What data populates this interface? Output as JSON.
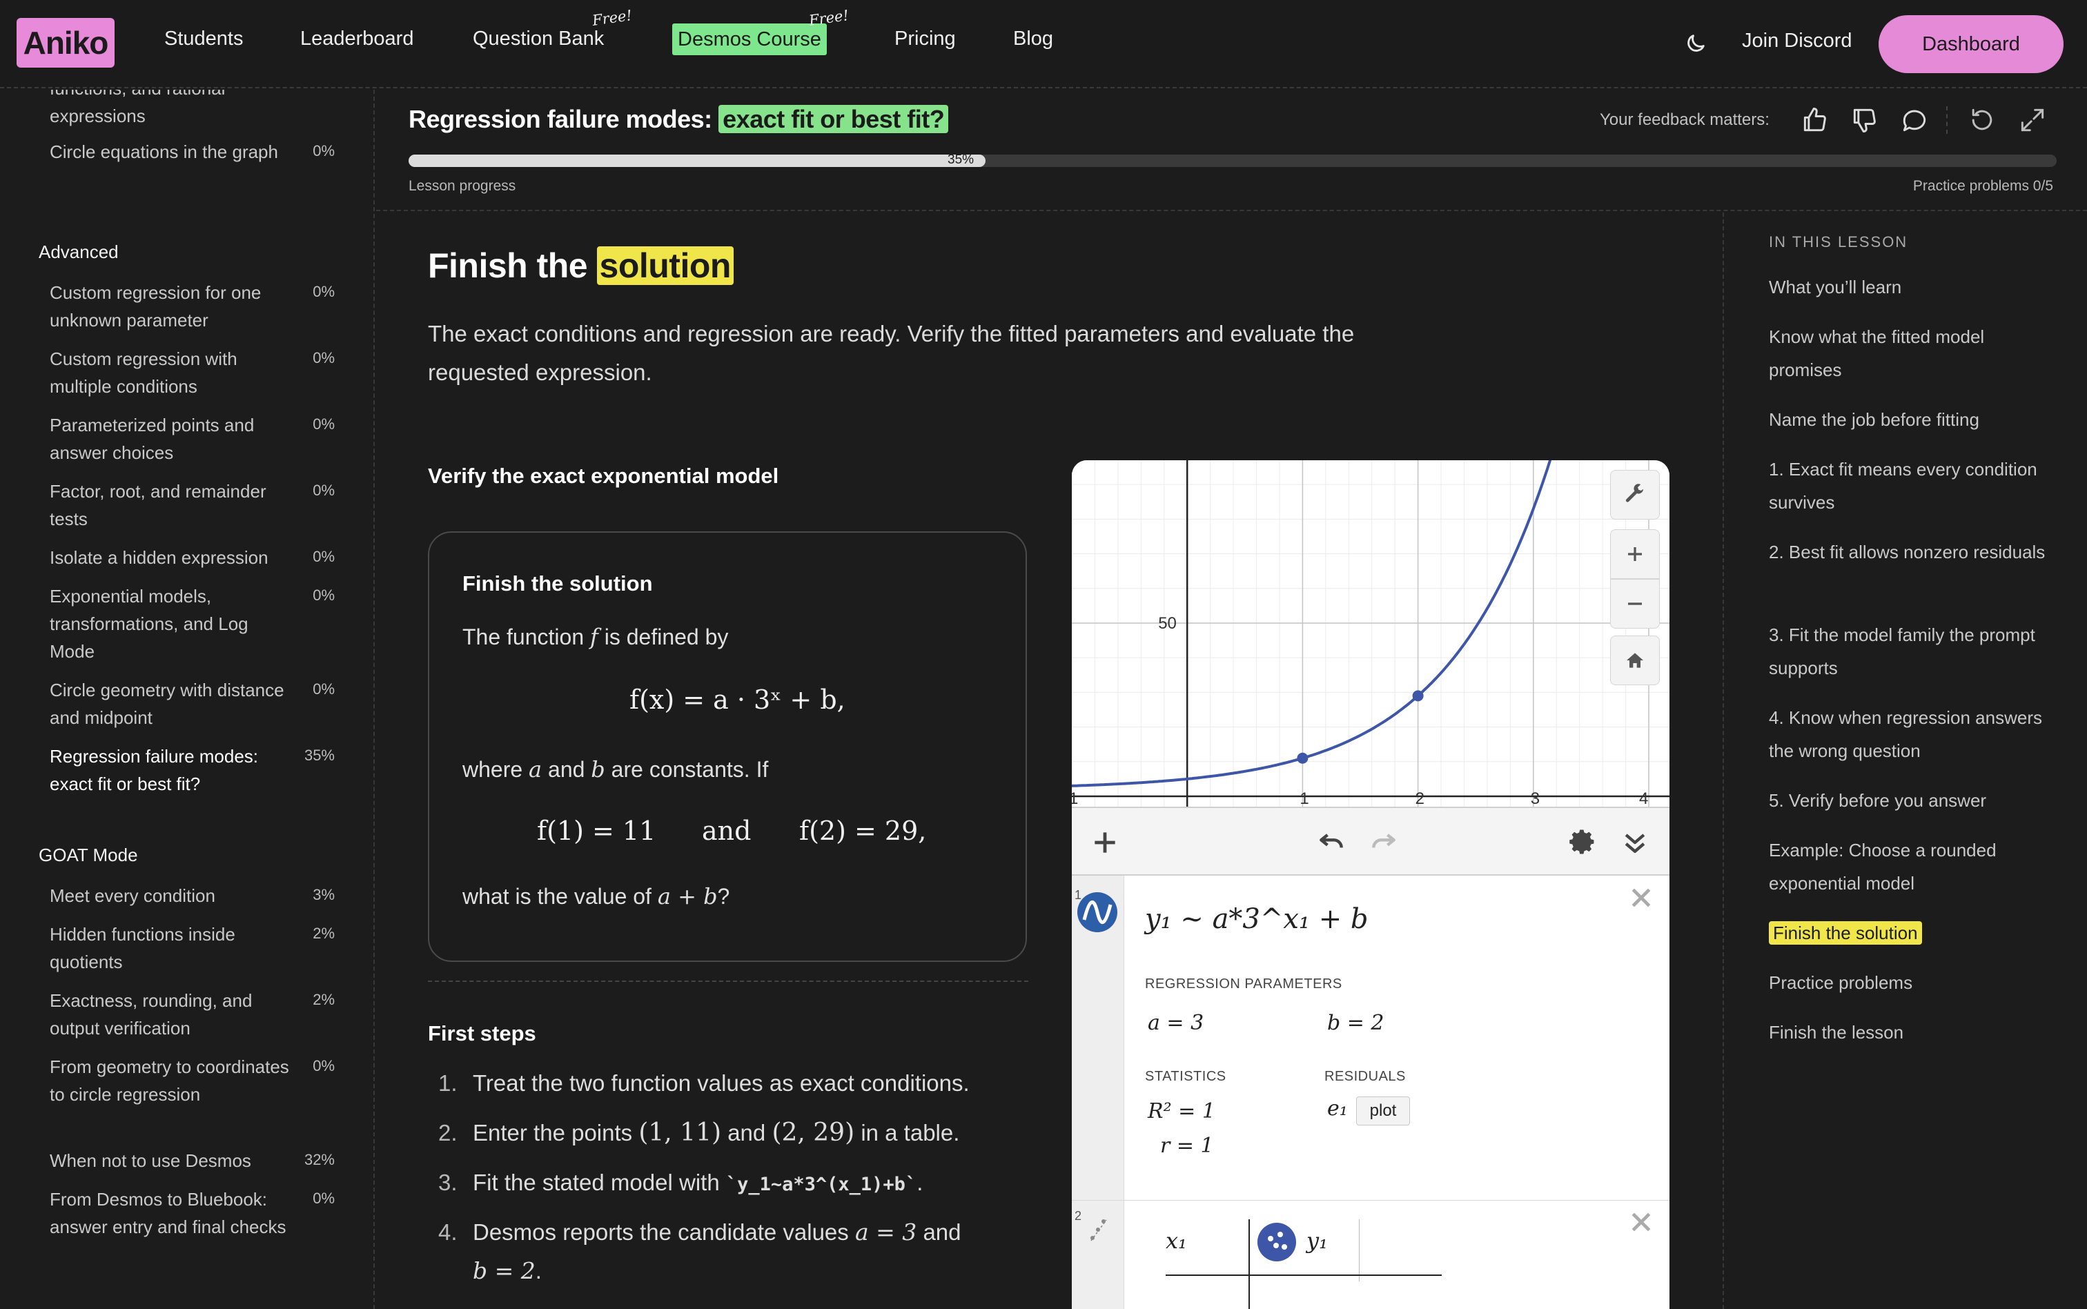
{
  "nav": {
    "logo": "Aniko",
    "students": "Students",
    "leaderboard": "Leaderboard",
    "question_bank": "Question Bank",
    "question_bank_badge": "Free!",
    "desmos_course": "Desmos Course",
    "desmos_course_badge": "Free!",
    "pricing": "Pricing",
    "blog": "Blog",
    "join_discord": "Join Discord",
    "dashboard": "Dashboard"
  },
  "sidebar": {
    "partial_item": "functions, and rational expressions",
    "items_top": [
      {
        "label": "Circle equations in the graph",
        "pct": "0%"
      }
    ],
    "advanced_heading": "Advanced",
    "advanced": [
      {
        "label": "Custom regression for one unknown parameter",
        "pct": "0%"
      },
      {
        "label": "Custom regression with multiple conditions",
        "pct": "0%"
      },
      {
        "label": "Parameterized points and answer choices",
        "pct": "0%"
      },
      {
        "label": "Factor, root, and remainder tests",
        "pct": "0%"
      },
      {
        "label": "Isolate a hidden expression",
        "pct": "0%"
      },
      {
        "label": "Exponential models, transformations, and Log Mode",
        "pct": "0%"
      },
      {
        "label": "Circle geometry with distance and midpoint",
        "pct": "0%"
      },
      {
        "label": "Regression failure modes: exact fit or best fit?",
        "pct": "35%"
      }
    ],
    "goat_heading": "GOAT Mode",
    "goat": [
      {
        "label": "Meet every condition",
        "pct": "3%"
      },
      {
        "label": "Hidden functions inside quotients",
        "pct": "2%"
      },
      {
        "label": "Exactness, rounding, and output verification",
        "pct": "2%"
      },
      {
        "label": "From geometry to coordinates to circle regression",
        "pct": "0%"
      },
      {
        "label": "When not to use Desmos",
        "pct": "32%"
      },
      {
        "label": "From Desmos to Bluebook: answer entry and final checks",
        "pct": "0%"
      }
    ]
  },
  "lesson": {
    "title_prefix": "Regression failure modes:",
    "title_highlight": "exact fit or best fit?",
    "feedback_label": "Your feedback matters:",
    "progress": 0.35,
    "progress_text": "35%",
    "progress_label": "Lesson progress",
    "practice_label": "Practice problems 0/5"
  },
  "main": {
    "heading_prefix": "Finish the",
    "heading_highlight": "solution",
    "intro": "The exact conditions and regression are ready. Verify the fitted parameters and evaluate the requested expression.",
    "section_title": "Verify the exact exponential model",
    "problem": {
      "title": "Finish the solution",
      "line1_a": "The function",
      "line1_var": "f",
      "line1_b": "is defined by",
      "equation": "f(x) = a · 3ˣ + b,",
      "line2_a": "where",
      "line2_v1": "a",
      "line2_and": "and",
      "line2_v2": "b",
      "line2_b": "are constants. If",
      "cond1": "f(1) = 11",
      "cond_and": "and",
      "cond2": "f(2) = 29,",
      "line3_a": "what is the value of",
      "line3_expr": "a + b",
      "line3_q": "?"
    },
    "steps_title": "First steps",
    "steps": [
      {
        "num": "1.",
        "text": "Treat the two function values as exact conditions."
      },
      {
        "num": "2.",
        "text_a": "Enter the points",
        "p1": "(1, 11)",
        "and": "and",
        "p2": "(2, 29)",
        "text_b": "in a table."
      },
      {
        "num": "3.",
        "text_a": "Fit the stated model with",
        "code": "`y_1~a*3^(x_1)+b`",
        "text_b": "."
      },
      {
        "num": "4.",
        "text_a": "Desmos reports the candidate values",
        "v1": "a = 3",
        "and": "and",
        "v2": "b = 2",
        "text_b": "."
      }
    ]
  },
  "desmos": {
    "axis": {
      "x_ticks": [
        "1",
        "1",
        "2",
        "3",
        "4"
      ],
      "y_tick": "50"
    },
    "expr1_num": "1",
    "expr1": "y₁ ~ a*3^x₁ + b",
    "regression_label": "REGRESSION PARAMETERS",
    "param_a": "a = 3",
    "param_b": "b = 2",
    "statistics_label": "STATISTICS",
    "residuals_label": "RESIDUALS",
    "r2": "R² = 1",
    "r": "r = 1",
    "residual_var": "e₁",
    "plot_button": "plot",
    "expr2_num": "2",
    "table_col1": "x₁",
    "table_col2": "y₁",
    "curve_color": "#3d56a8"
  },
  "toc": {
    "heading": "IN THIS LESSON",
    "items": [
      "What you’ll learn",
      "Know what the fitted model promises",
      "Name the job before fitting",
      "1. Exact fit means every condition survives",
      "2. Best fit allows nonzero residuals",
      "3. Fit the model family the prompt supports",
      "4. Know when regression answers the wrong question",
      "5. Verify before you answer",
      "Example: Choose a rounded exponential model",
      "Finish the solution",
      "Practice problems",
      "Finish the lesson"
    ]
  }
}
